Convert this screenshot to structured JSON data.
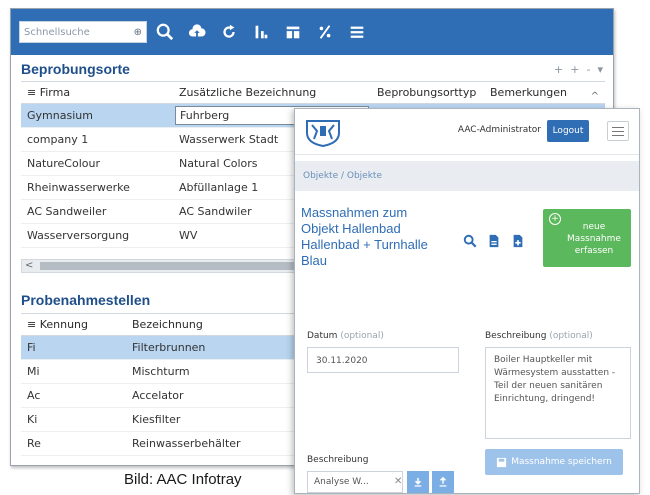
{
  "toolbar": {
    "search_placeholder": "Schnellsuche",
    "icons": [
      "search-icon",
      "cloud-upload-icon",
      "refresh-icon",
      "sort-icon",
      "table-icon",
      "percent-icon",
      "hamburger-menu-icon"
    ]
  },
  "sampling_sites": {
    "title": "Beprobungsorte",
    "tools": [
      "+",
      "+",
      "-",
      "▾"
    ],
    "columns": [
      "≡ Firma",
      "Zusätzliche Bezeichnung",
      "Beprobungsorttyp",
      "Bemerkungen"
    ],
    "rows": [
      [
        "Gymnasium",
        "Fuhrberg"
      ],
      [
        "company 1",
        "Wasserwerk Stadt"
      ],
      [
        "NatureColour",
        "Natural Colors"
      ],
      [
        "Rheinwasserwerke",
        "Abfüllanlage 1"
      ],
      [
        "AC Sandweiler",
        "AC Sandwiler"
      ],
      [
        "Wasserversorgung",
        "WV"
      ]
    ],
    "sort_arrow": "^",
    "scroll_left": "<"
  },
  "sampling_points": {
    "title": "Probenahmestellen",
    "columns": [
      "≡ Kennung",
      "Bezeichnung"
    ],
    "rows": [
      [
        "Fi",
        "Filterbrunnen"
      ],
      [
        "Mi",
        "Mischturm"
      ],
      [
        "Ac",
        "Accelator"
      ],
      [
        "Ki",
        "Kiesfilter"
      ],
      [
        "Re",
        "Reinwasserbehälter"
      ]
    ]
  },
  "front": {
    "user": "AAC-Administrator",
    "logout_label": "Logout",
    "breadcrumb": "Objekte / Objekte",
    "title_lines": [
      "Massnahmen zum",
      "Objekt Hallenbad",
      "Hallenbad + Turnhalle",
      "Blau"
    ],
    "new_button_lines": [
      "neue",
      "Massnahme",
      "erfassen"
    ],
    "new_button_plus": "+",
    "date_label": "Datum",
    "date_optional": "(optional)",
    "date_value": "30.11.2020",
    "desc_label": "Beschreibung",
    "desc_optional": "(optional)",
    "desc_value": "Boiler Hauptkeller mit Wärmesystem ausstatten - Teil der neuen sanitären Einrichtung, dringend!",
    "file_label": "Beschreibung",
    "file_value": "Analyse W...",
    "file_clear": "✕",
    "save_label": "Massnahme speichern"
  },
  "caption": "Bild: AAC Infotray",
  "colors": {
    "brand_blue": "#2f6db5",
    "selection": "#b9d5f0",
    "green": "#5cb85c"
  }
}
